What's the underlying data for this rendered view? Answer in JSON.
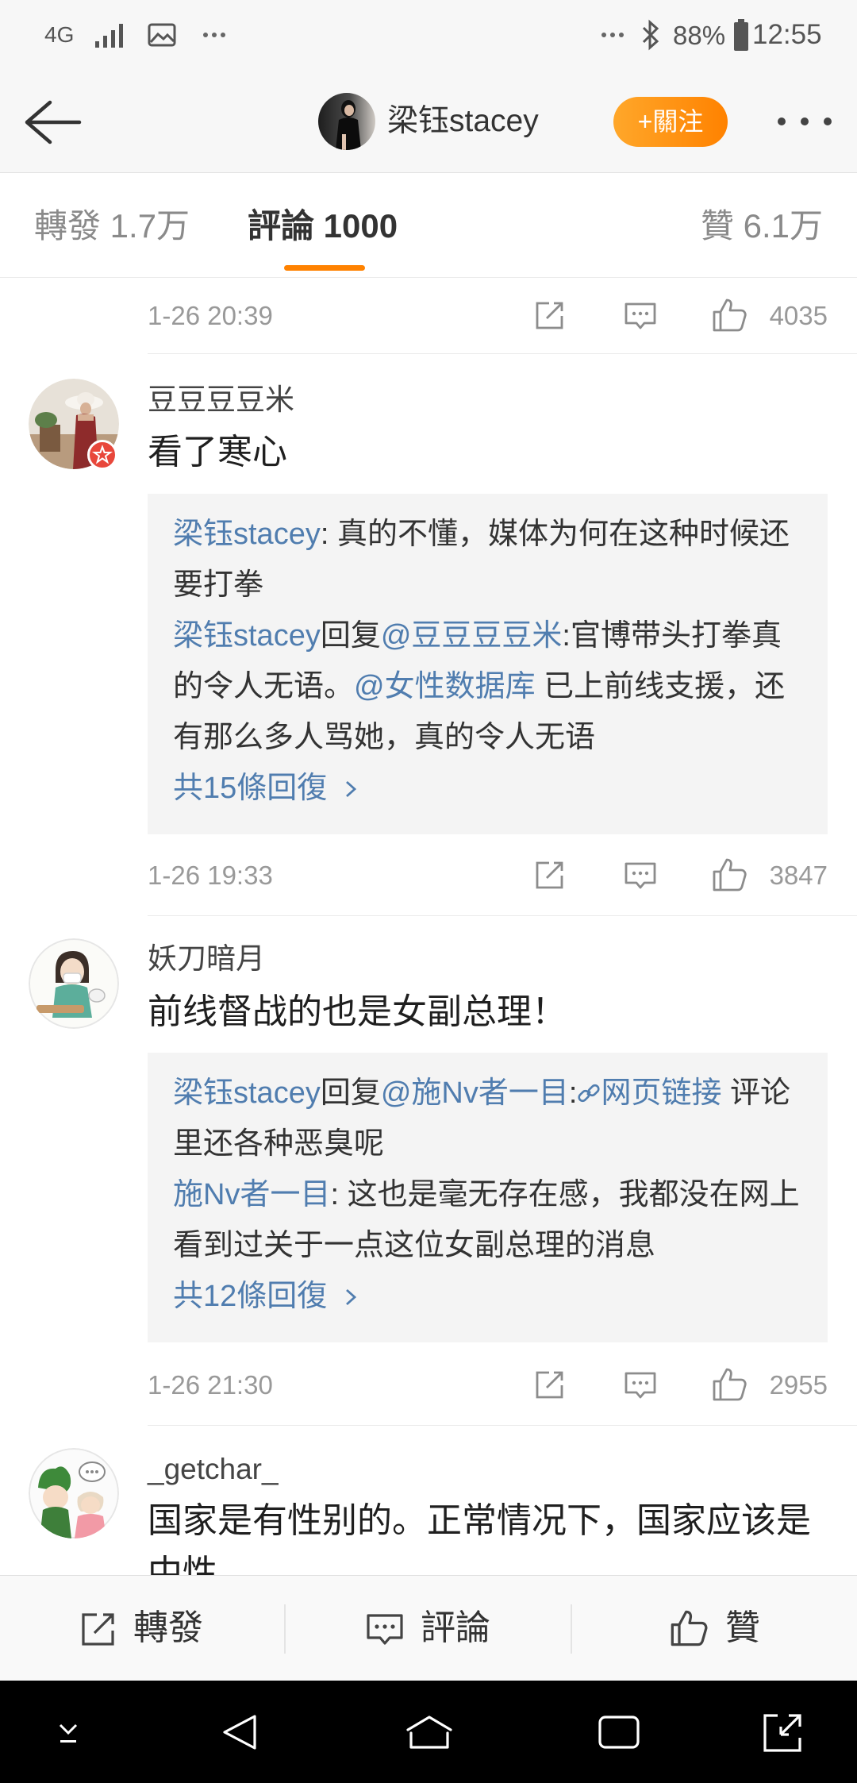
{
  "status_bar": {
    "network": "4G",
    "battery_percent": "88%",
    "time": "12:55",
    "icons": [
      "signal-icon",
      "gallery-icon",
      "notification-dots-icon",
      "bluetooth-icon",
      "battery-icon"
    ]
  },
  "header": {
    "title": "梁钰stacey",
    "follow_label": "+關注",
    "icons": {
      "back": "back-arrow-icon",
      "more": "more-dots-icon"
    }
  },
  "tabs": [
    {
      "label": "轉發 1.7万",
      "active": false
    },
    {
      "label": "評論 1000",
      "active": true
    },
    {
      "label": "贊 6.1万",
      "active": false
    }
  ],
  "comments": [
    {
      "time": "1-26 20:39",
      "likes": "4035"
    },
    {
      "user": "豆豆豆豆米",
      "verified": true,
      "content": "看了寒心",
      "replies": [
        {
          "segments": [
            {
              "type": "link",
              "text": "梁钰stacey"
            },
            {
              "type": "text",
              "text": ": 真的不懂，媒体为何在这种时候还要打拳"
            }
          ]
        },
        {
          "segments": [
            {
              "type": "link",
              "text": "梁钰stacey"
            },
            {
              "type": "text",
              "text": "回复"
            },
            {
              "type": "link",
              "text": "@豆豆豆豆米"
            },
            {
              "type": "text",
              "text": ":官博带头打拳真的令人无语。"
            },
            {
              "type": "link",
              "text": "@女性数据库"
            },
            {
              "type": "text",
              "text": " 已上前线支援，还有那么多人骂她，真的令人无语"
            }
          ]
        }
      ],
      "more_replies": "共15條回復",
      "time": "1-26 19:33",
      "likes": "3847"
    },
    {
      "user": "妖刀暗月",
      "verified": false,
      "content": "前线督战的也是女副总理！",
      "replies": [
        {
          "segments": [
            {
              "type": "link",
              "text": "梁钰stacey"
            },
            {
              "type": "text",
              "text": "回复"
            },
            {
              "type": "link",
              "text": "@施Nv者一目"
            },
            {
              "type": "text",
              "text": ":"
            },
            {
              "type": "icon",
              "text": "link-chain-icon"
            },
            {
              "type": "link",
              "text": "网页链接"
            },
            {
              "type": "text",
              "text": " 评论里还各种恶臭呢"
            }
          ]
        },
        {
          "segments": [
            {
              "type": "link",
              "text": "施Nv者一目"
            },
            {
              "type": "text",
              "text": ": 这也是毫无存在感，我都没在网上看到过关于一点这位女副总理的消息"
            }
          ]
        }
      ],
      "more_replies": "共12條回復",
      "time": "1-26 21:30",
      "likes": "2955"
    },
    {
      "user": "_getchar_",
      "verified": false,
      "content": "国家是有性别的。正常情况下，国家应该是中性。"
    }
  ],
  "bottom_bar": {
    "repost": "轉發",
    "comment": "評論",
    "like": "贊"
  },
  "colors": {
    "accent": "#ff8200",
    "link": "#507daf",
    "muted": "#999999",
    "reply_bg": "#f4f4f4",
    "badge": "#e8473b"
  }
}
